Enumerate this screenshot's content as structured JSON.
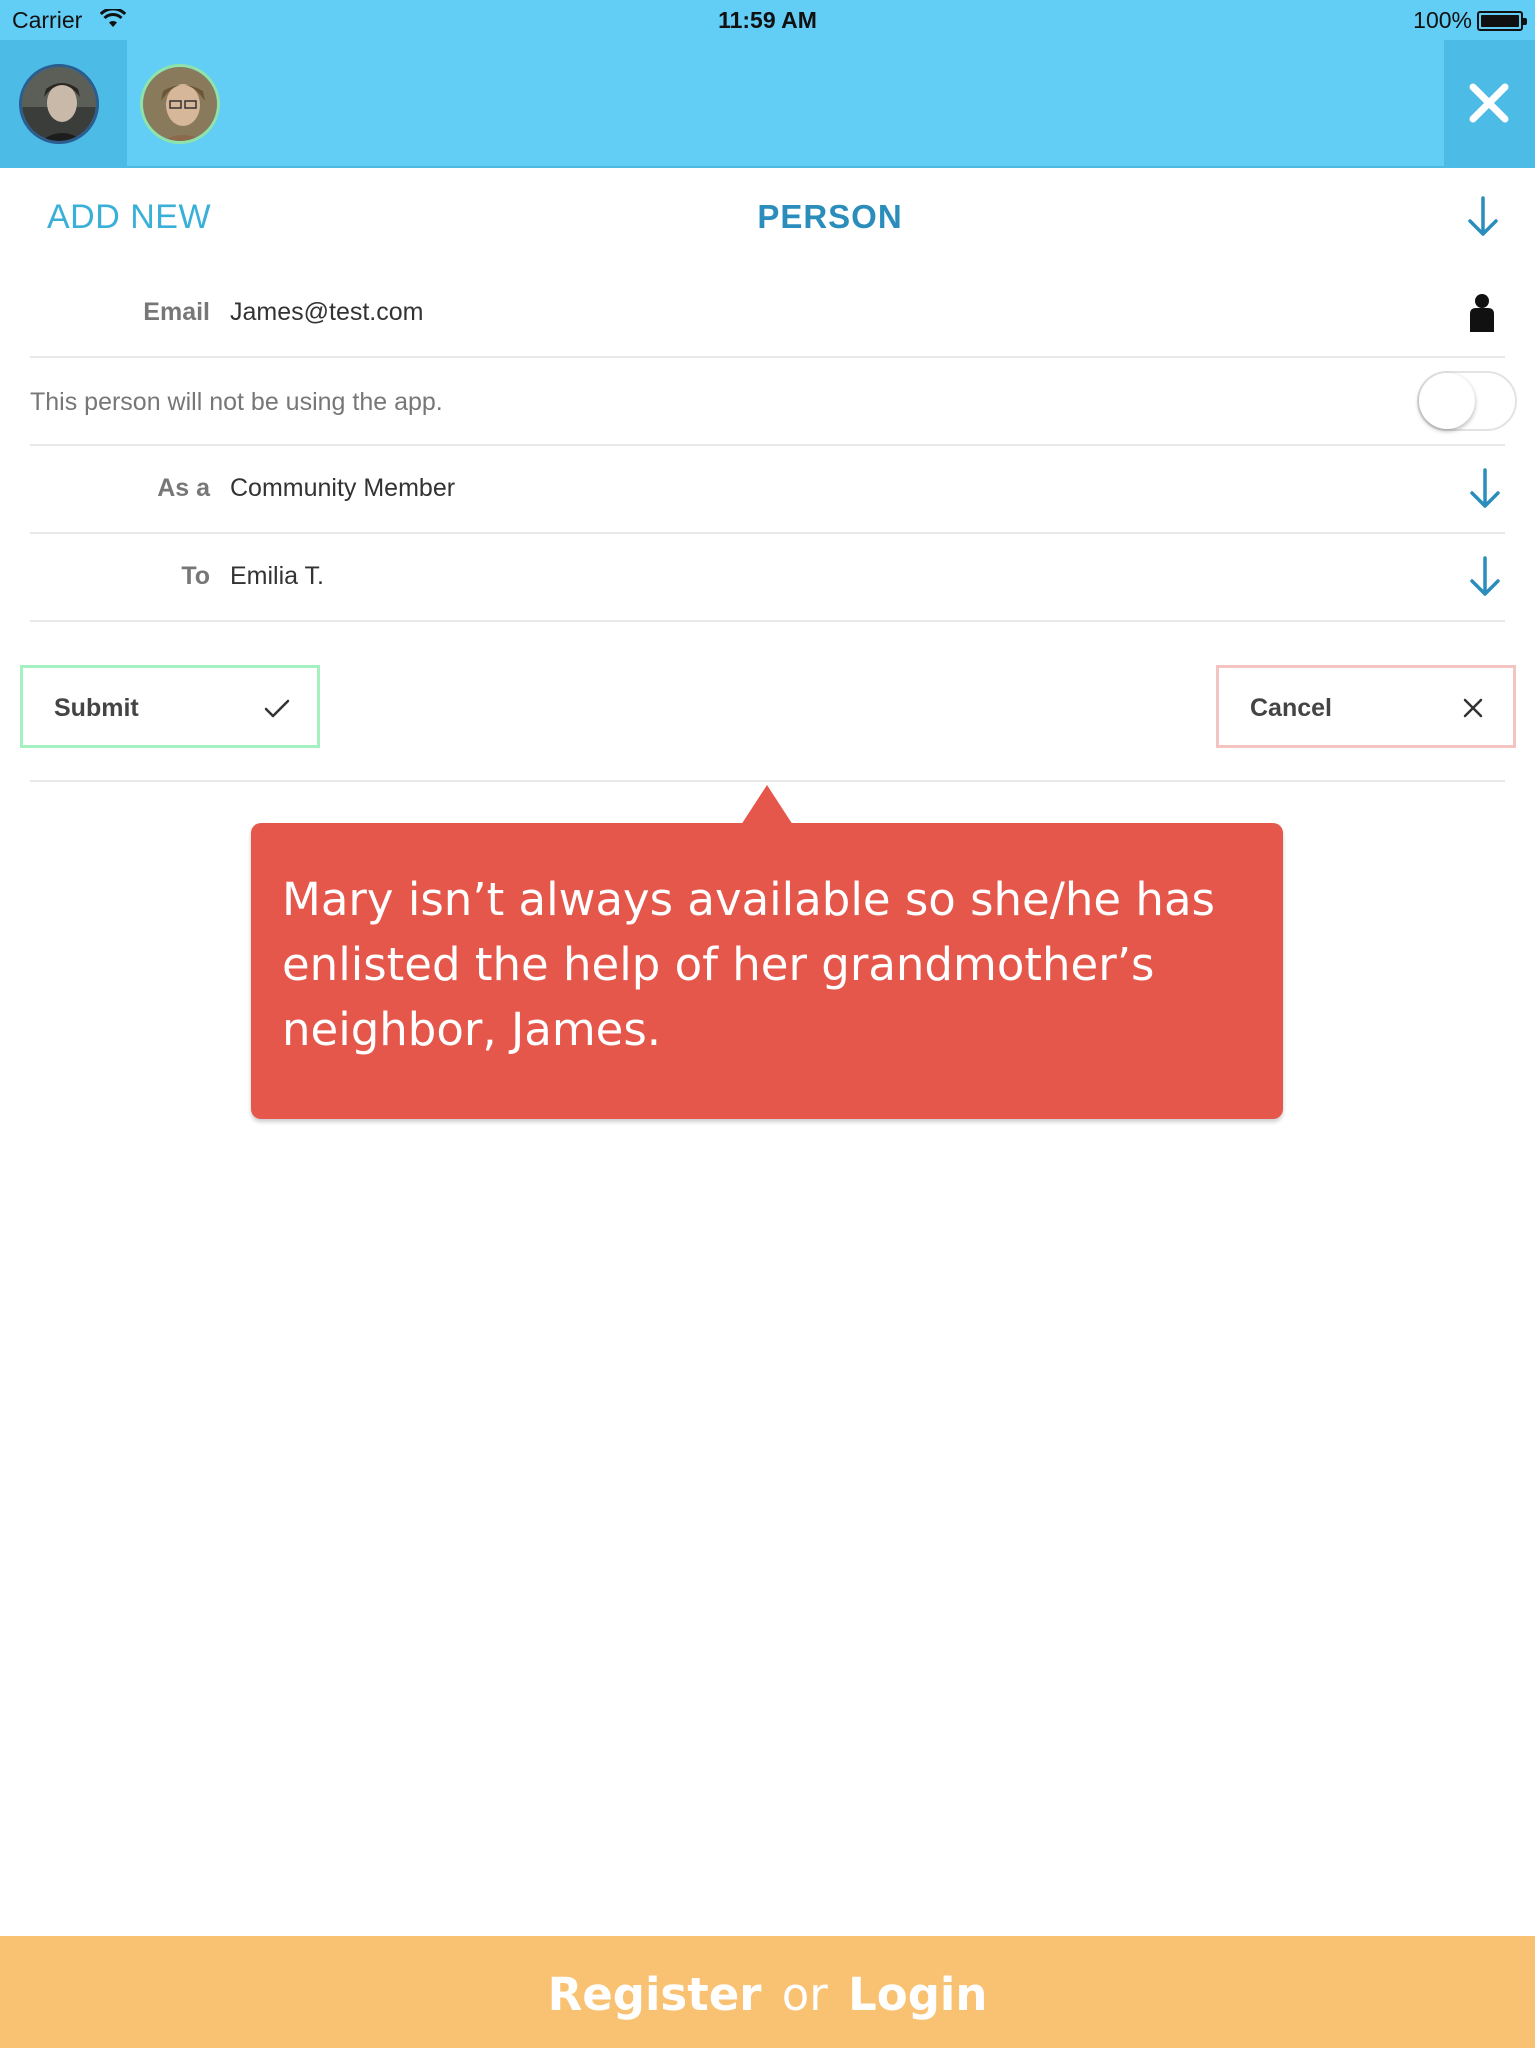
{
  "status_bar": {
    "carrier": "Carrier",
    "time": "11:59 AM",
    "battery": "100%"
  },
  "header": {
    "avatars": [
      {
        "icon": "user-avatar-photo"
      },
      {
        "icon": "user-avatar-photo"
      }
    ],
    "close_icon": "close-icon"
  },
  "form": {
    "add_new_label": "ADD NEW",
    "title": "PERSON",
    "email": {
      "label": "Email",
      "value": "James@test.com",
      "icon": "person-icon"
    },
    "not_using_app": {
      "text": "This person will not be using the app.",
      "toggle_on": false
    },
    "as_a": {
      "label": "As a",
      "value": "Community Member"
    },
    "to": {
      "label": "To",
      "value": "Emilia T."
    },
    "submit_label": "Submit",
    "cancel_label": "Cancel"
  },
  "tooltip": {
    "text": "Mary isn’t always available so she/he has enlisted the help of her grandmother’s neighbor, James."
  },
  "footer": {
    "register": "Register",
    "or": "or",
    "login": "Login"
  },
  "colors": {
    "header": "#62cdf5",
    "accent": "#2a8dbc",
    "tooltip": "#e5574b",
    "footer": "#f9c172",
    "submit_border": "#a5f0c0",
    "cancel_border": "#f4c4c0"
  }
}
